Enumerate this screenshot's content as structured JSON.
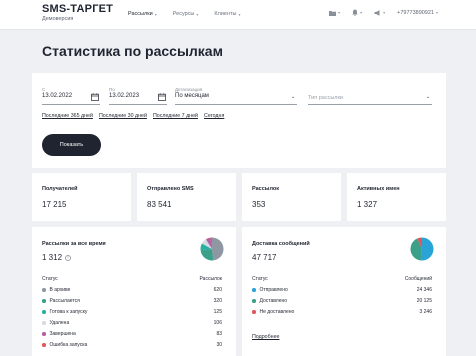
{
  "header": {
    "brand": "SMS-ТАРГЕТ",
    "account": "Демоверсия",
    "nav": [
      {
        "label": "Рассылки"
      },
      {
        "label": "Ресурсы"
      },
      {
        "label": "Клиенты"
      }
    ],
    "phone": "+79773890921",
    "icons": [
      "folder-icon",
      "bell-icon",
      "megaphone-icon"
    ]
  },
  "page": {
    "title": "Статистика по рассылкам"
  },
  "filters": {
    "from_label": "С",
    "from_value": "13.02.2022",
    "to_label": "По",
    "to_value": "13.02.2023",
    "detail_label": "Детализация",
    "detail_value": "По месяцам",
    "type_placeholder": "Тип рассылки",
    "quick_links": [
      "Последние 365 дней",
      "Последние 30 дней",
      "Последние 7 дней",
      "Сегодня"
    ],
    "show_button": "Показать"
  },
  "stats": [
    {
      "label": "Получателей",
      "value": "17 215"
    },
    {
      "label": "Отправлено SMS",
      "value": "83 541"
    },
    {
      "label": "Рассылок",
      "value": "353"
    },
    {
      "label": "Активных имен",
      "value": "1 327"
    }
  ],
  "mailings_panel": {
    "title": "Рассылки за все время",
    "total": "1 312",
    "col_status": "Статус",
    "col_count": "Рассылок",
    "rows": [
      {
        "label": "В архиве",
        "value": "620",
        "color": "#8f97a3"
      },
      {
        "label": "Рассылается",
        "value": "320",
        "color": "#3aa08a"
      },
      {
        "label": "Готова к запуску",
        "value": "125",
        "color": "#2ab0a0"
      },
      {
        "label": "Удалена",
        "value": "106",
        "color": "#d6dae0"
      },
      {
        "label": "Завершена",
        "value": "83",
        "color": "#b45fa8"
      },
      {
        "label": "Ошибка запуска",
        "value": "30",
        "color": "#e0565b"
      }
    ]
  },
  "delivery_panel": {
    "title": "Доставка сообщений",
    "total": "47 717",
    "col_status": "Статус",
    "col_count": "Сообщений",
    "rows": [
      {
        "label": "Отправлено",
        "value": "24 346",
        "color": "#2aa3d6"
      },
      {
        "label": "Доставлено",
        "value": "20 125",
        "color": "#3aa08a"
      },
      {
        "label": "Не доставлено",
        "value": "3 246",
        "color": "#e0565b"
      }
    ],
    "details_link": "Подробнее"
  }
}
